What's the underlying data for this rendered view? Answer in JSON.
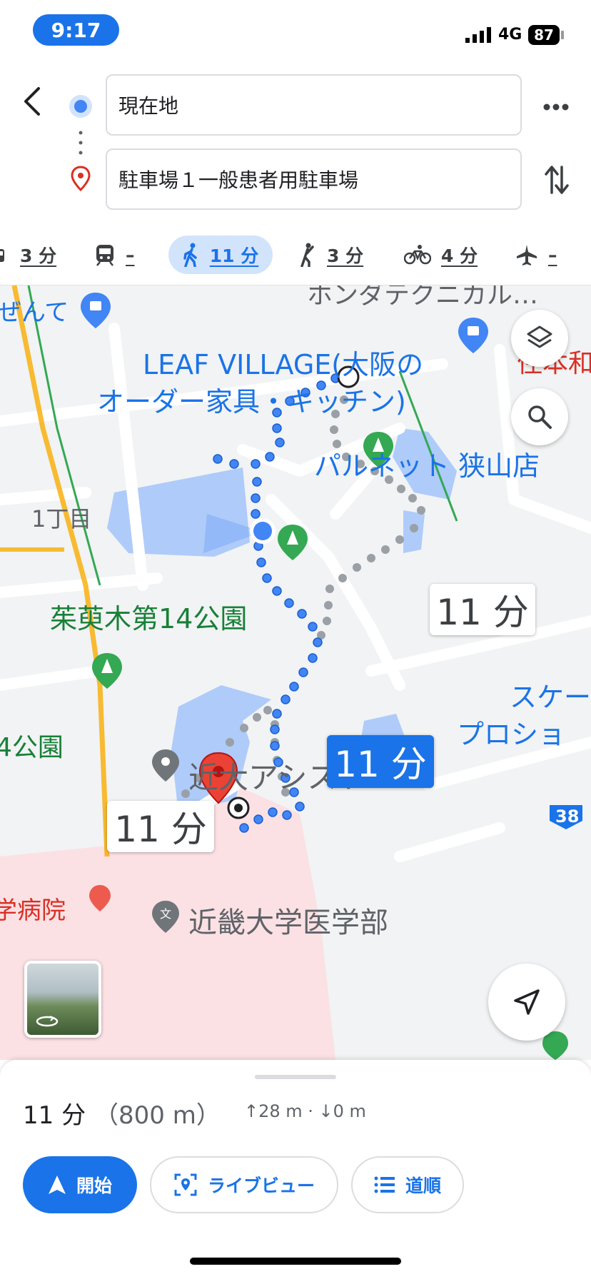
{
  "status_bar": {
    "time": "9:17",
    "network": "4G",
    "battery": "87"
  },
  "header": {
    "origin_value": "現在地",
    "destination_value": "駐車場１一般患者用駐車場"
  },
  "modes": [
    {
      "name": "drive",
      "value": "3 分"
    },
    {
      "name": "transit",
      "value": "–"
    },
    {
      "name": "walk",
      "value": "11 分",
      "selected": true
    },
    {
      "name": "ride",
      "value": "3 分"
    },
    {
      "name": "bike",
      "value": "4 分"
    },
    {
      "name": "flight",
      "value": "–"
    }
  ],
  "map": {
    "labels": {
      "shop_top_left": "ぜんて",
      "top_cut": "ホンダテクニカル…",
      "leaf_line1": "LEAF VILLAGE(大阪の",
      "leaf_line2": "オーダー家具・キッチン)",
      "top_right_cut": "住本和",
      "parunet": "パルネット 狭山店",
      "chome": "1丁目",
      "park14": "茱萸木第14公園",
      "park_left": "4公園",
      "skate_line1": "スケー",
      "skate_line2": "プロショ",
      "kindai_assist": "近大アシスト",
      "kindai_med": "近畿大学医学部",
      "univ_left": "学病院",
      "route_badge": "38"
    },
    "route_times": {
      "alt_right": "11 分",
      "main": "11 分",
      "alt_left": "11 分"
    }
  },
  "sheet": {
    "duration": "11 分",
    "distance": "（800 m）",
    "elevation": "↑28 m · ↓0 m",
    "buttons": {
      "start": "開始",
      "live_view": "ライブビュー",
      "steps": "道順"
    }
  },
  "colors": {
    "accent": "#1a73e8",
    "route_alt": "#9aa0a6",
    "destination_pin": "#d93025",
    "park_green": "#34a853"
  }
}
